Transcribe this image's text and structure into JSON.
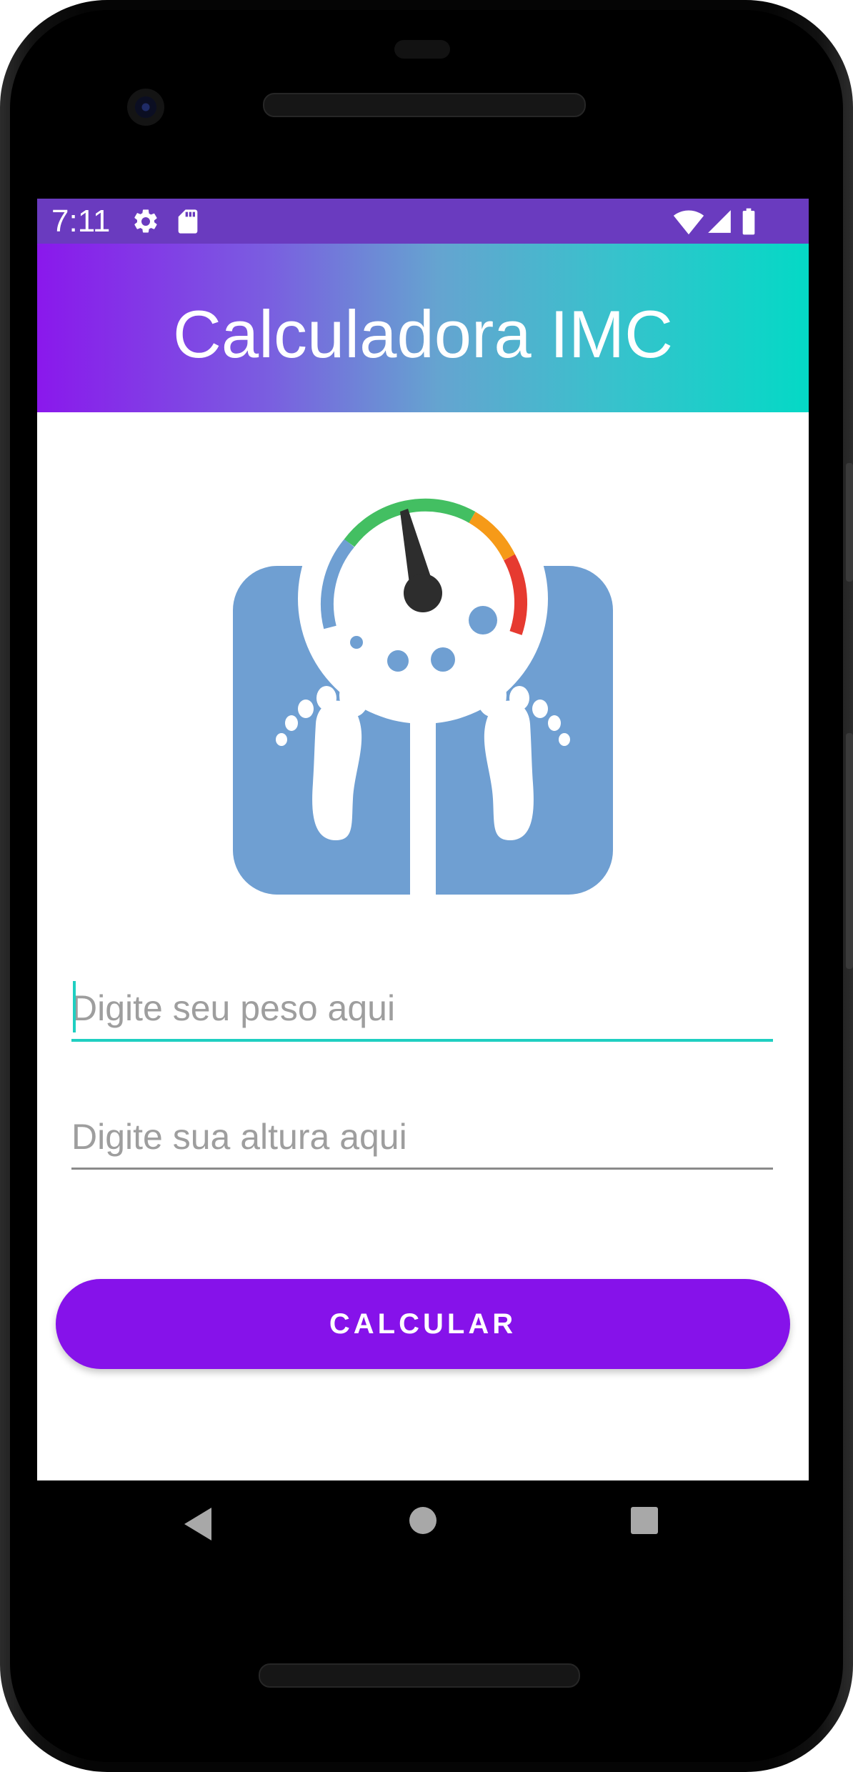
{
  "status_bar": {
    "time": "7:11",
    "left_icons": [
      "gear-icon",
      "sd-card-icon"
    ],
    "right_icons": [
      "wifi-icon",
      "cell-signal-icon",
      "battery-icon"
    ],
    "color": "#6a3bbf"
  },
  "app_bar": {
    "title": "Calculadora IMC",
    "gradient_start": "#8a18ec",
    "gradient_end": "#04d9c6"
  },
  "image": {
    "icon": "bathroom-scale-icon"
  },
  "form": {
    "weight_placeholder": "Digite seu peso aqui",
    "height_placeholder": "Digite sua altura aqui"
  },
  "button": {
    "label": "CALCULAR",
    "color": "#8612ea"
  },
  "nav_bar": {
    "icons": [
      "back-icon",
      "home-icon",
      "recents-icon"
    ]
  }
}
